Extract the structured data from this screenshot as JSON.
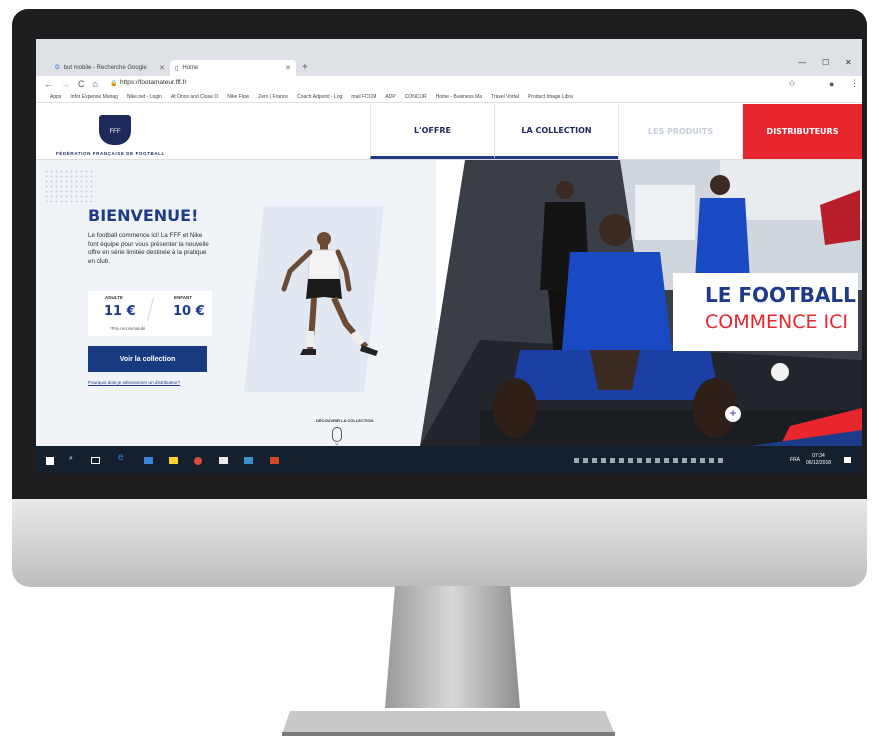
{
  "browser": {
    "tabs": [
      {
        "label": "but mobile - Recherche Google"
      },
      {
        "label": "Home"
      }
    ],
    "url": "https://footamateur.fff.fr",
    "bookmarks": [
      "Apps",
      "Infor Expense Manag",
      "Nike.net - Login",
      "At Once and Close O",
      "Nike Flow",
      "Zero | France",
      "Coach Adpoint - Log",
      "mail FCCM",
      "ADP",
      "CONCUR",
      "Home - Business Ma",
      "Travel Vortal",
      "Product Image Libra"
    ]
  },
  "site": {
    "federation": "FÉDÉRATION FRANÇAISE DE FOOTBALL",
    "logo_text": "FFF",
    "menu": [
      "L'OFFRE",
      "LA COLLECTION",
      "LES PRODUITS",
      "DISTRIBUTEURS"
    ],
    "heading": "BIENVENUE!",
    "intro": "Le football commence ici! La FFF et Nike font équipe pour vous présenter la nouvelle offre en série limitée destinée à la pratique en club.",
    "prices": {
      "adult_label": "ADULTE",
      "adult_value": "11 €",
      "child_label": "ENFANT",
      "child_value": "10 €",
      "note": "*Prix recommandé"
    },
    "cta": "Voir la collection",
    "dealer_link": "Pourquoi dois-je sélectionner un distributeur?",
    "discover": "DÉCOUVRIR LA COLLECTION",
    "slogan_line1": "LE FOOTBALL",
    "slogan_line2": "COMMENCE ICI"
  },
  "taskbar": {
    "lang": "FRA",
    "time": "07:34",
    "date": "06/12/2018"
  },
  "colors": {
    "navy": "#1e3b8a",
    "red": "#e8262e",
    "chrome": "#dee1e6"
  }
}
